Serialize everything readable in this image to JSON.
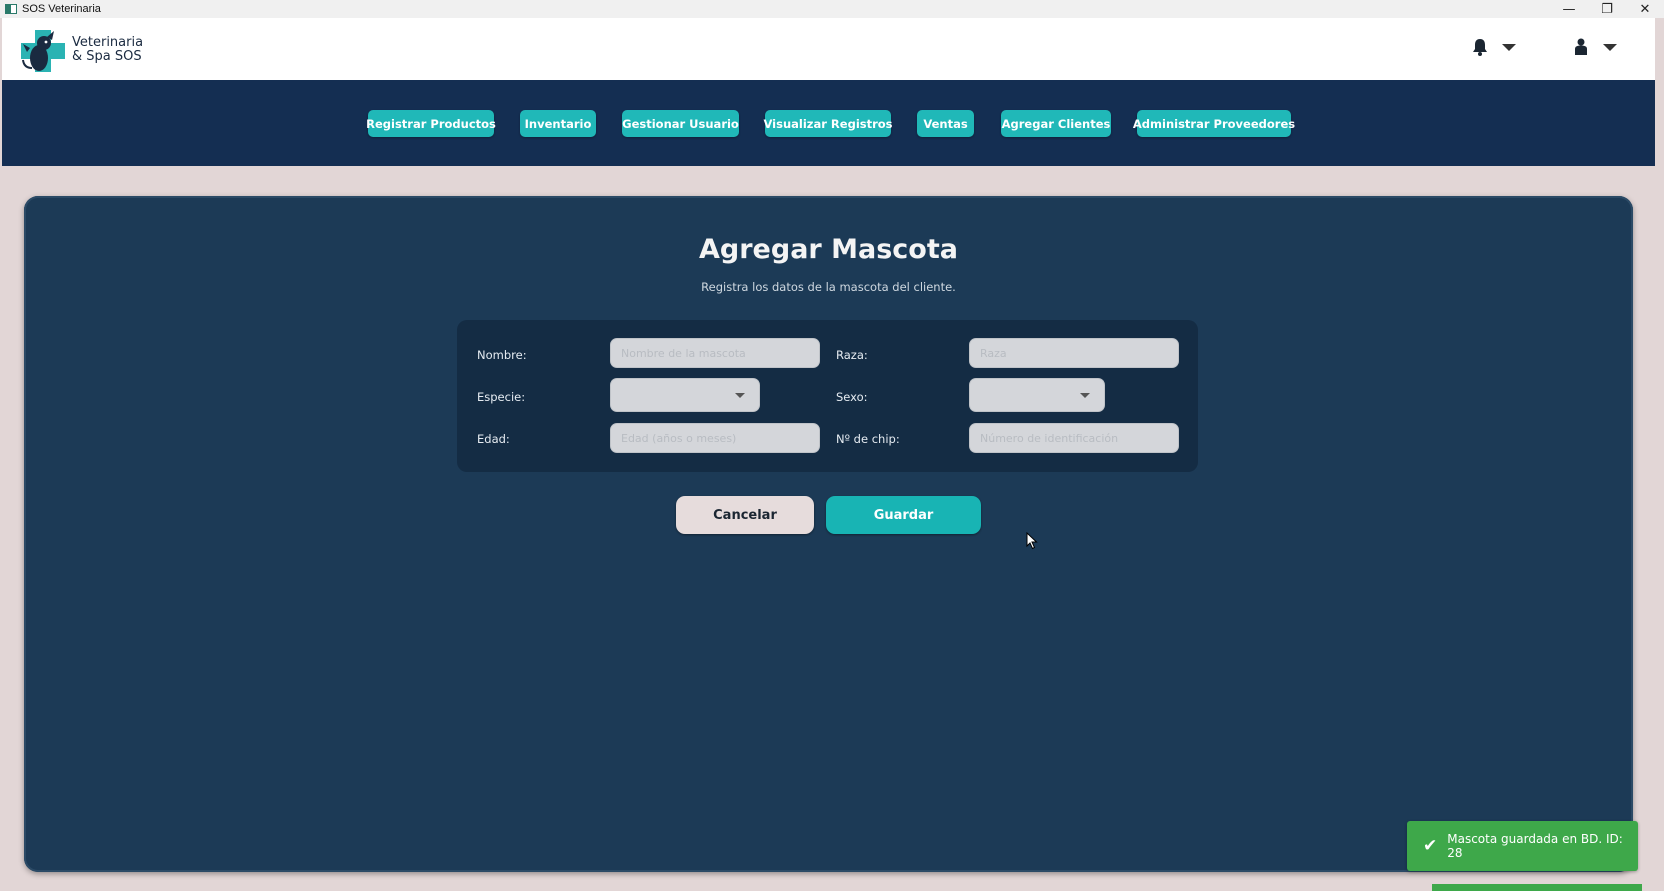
{
  "window": {
    "title": "SOS Veterinaria",
    "controls": [
      "—",
      "❐",
      "✕"
    ]
  },
  "brand": {
    "line1": "Veterinaria",
    "line2": "& Spa SOS"
  },
  "nav": [
    "Registrar Productos",
    "Inventario",
    "Gestionar Usuario",
    "Visualizar Registros",
    "Ventas",
    "Agregar Clientes",
    "Administrar Proveedores"
  ],
  "page": {
    "title": "Agregar Mascota",
    "subtitle": "Registra los datos de la mascota del cliente."
  },
  "form": {
    "nombre_label": "Nombre:",
    "nombre_placeholder": "Nombre de la mascota",
    "raza_label": "Raza:",
    "raza_placeholder": "Raza",
    "especie_label": "Especie:",
    "especie_value": "",
    "sexo_label": "Sexo:",
    "sexo_value": "",
    "edad_label": "Edad:",
    "edad_placeholder": "Edad (años o meses)",
    "chip_label": "Nº de chip:",
    "chip_placeholder": "Número de identificación"
  },
  "buttons": {
    "cancel": "Cancelar",
    "save": "Guardar"
  },
  "toast": {
    "message": "Mascota guardada en BD. ID: 28",
    "icon": "check-icon"
  },
  "colors": {
    "nav_bg": "#142e52",
    "panel_bg": "#1c3a56",
    "accent": "#20b8b8",
    "toast": "#3ea84a"
  }
}
